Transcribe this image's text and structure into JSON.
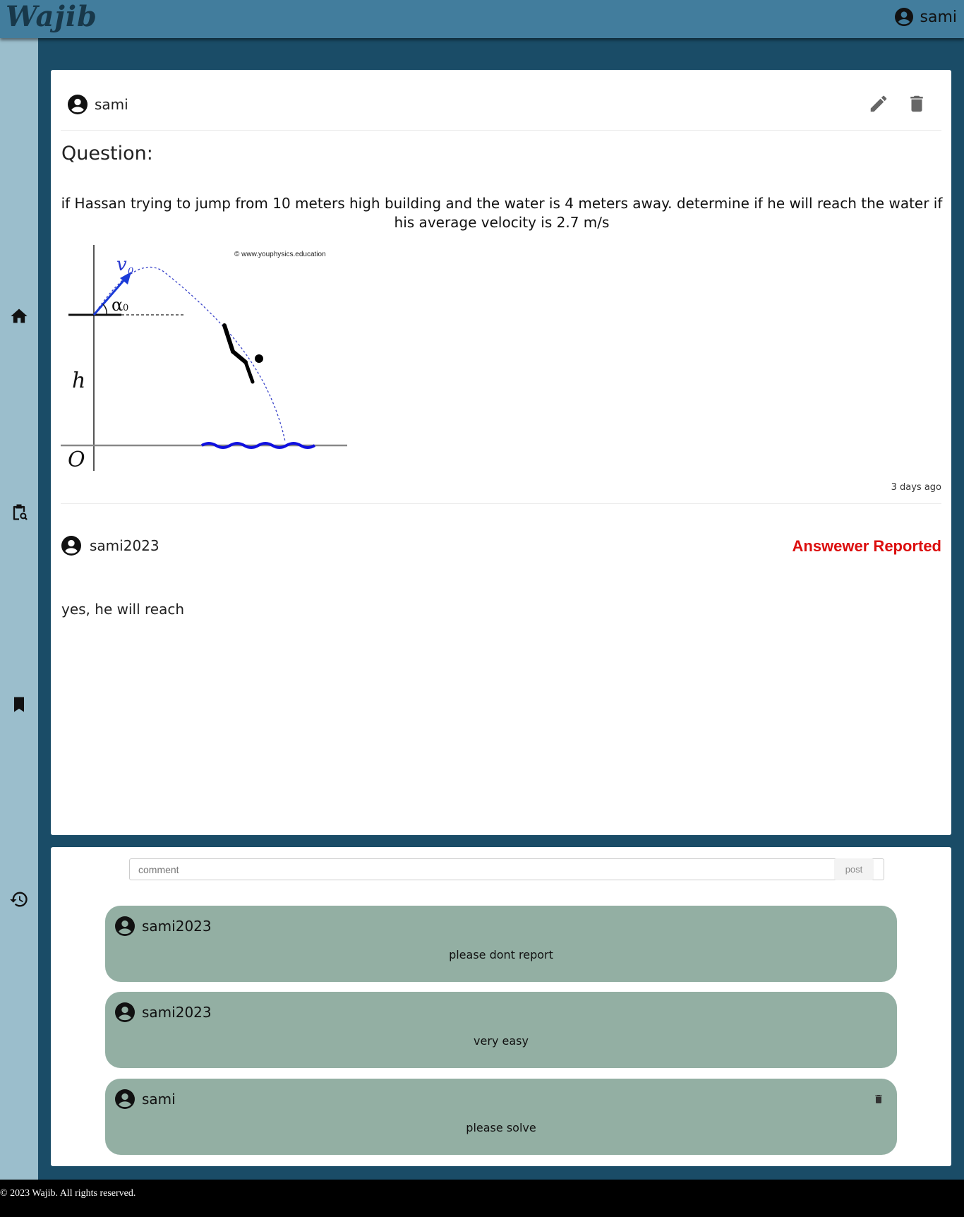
{
  "app": {
    "logo": "Wajib",
    "current_user": "sami"
  },
  "sidebar": {
    "items": [
      {
        "name": "home",
        "icon": "home-icon"
      },
      {
        "name": "search-questions",
        "icon": "clipboard-search-icon"
      },
      {
        "name": "bookmarks",
        "icon": "bookmark-icon"
      },
      {
        "name": "history",
        "icon": "history-icon"
      }
    ]
  },
  "question": {
    "author": "sami",
    "label": "Question:",
    "text": "if Hassan trying to jump from 10 meters high building and the water is 4 meters away. determine if he will reach the water if his average velocity is 2.7 m/s",
    "time": "3 days ago",
    "figure": {
      "credit": "© www.youphysics.education",
      "velocity_label": "v",
      "velocity_sub": "0",
      "angle_label": "α",
      "angle_sub": "0",
      "height_label": "h",
      "origin_label": "O"
    }
  },
  "answer": {
    "author": "sami2023",
    "status": "Answewer Reported",
    "text": "yes, he will reach"
  },
  "comment_form": {
    "placeholder": "comment",
    "value": "",
    "post_label": "post"
  },
  "comments": [
    {
      "author": "sami2023",
      "text": "please dont report",
      "deletable": false
    },
    {
      "author": "sami2023",
      "text": "very easy",
      "deletable": false
    },
    {
      "author": "sami",
      "text": "please solve",
      "deletable": true
    }
  ],
  "footer": {
    "text": "© 2023 Wajib. All rights reserved."
  },
  "colors": {
    "topbar": "#427d9d",
    "sidebar": "#9bbecc",
    "background": "#1a4c67",
    "comment_bg": "#93afa3",
    "reported": "#dc0e0e"
  }
}
